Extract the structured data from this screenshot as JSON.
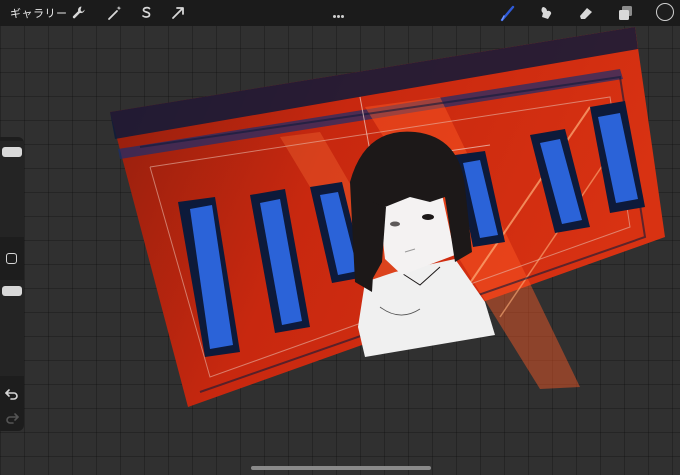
{
  "toolbar": {
    "gallery_label": "ギャラリー",
    "left_tools": [
      "wrench-icon",
      "magic-wand-icon",
      "selection-icon",
      "transform-arrow-icon"
    ],
    "right_tools": [
      "brush-icon",
      "smudge-icon",
      "eraser-icon",
      "layers-icon"
    ],
    "active_tool": "brush-icon",
    "active_color": "#2f5bd9",
    "current_color": "#1e1e1e"
  },
  "sidebar": {
    "brush_size_level": 0.05,
    "opacity_level": 0.05,
    "undo_icon": "undo-icon",
    "redo_icon": "redo-icon"
  },
  "artwork": {
    "palette": {
      "background_red": "#d42a10",
      "shadow_red": "#8e1e0e",
      "window_blue": "#2b63d8",
      "frame_navy": "#0d1a3a",
      "hair_black": "#1c1818",
      "skin_white": "#f0f0f0"
    }
  }
}
